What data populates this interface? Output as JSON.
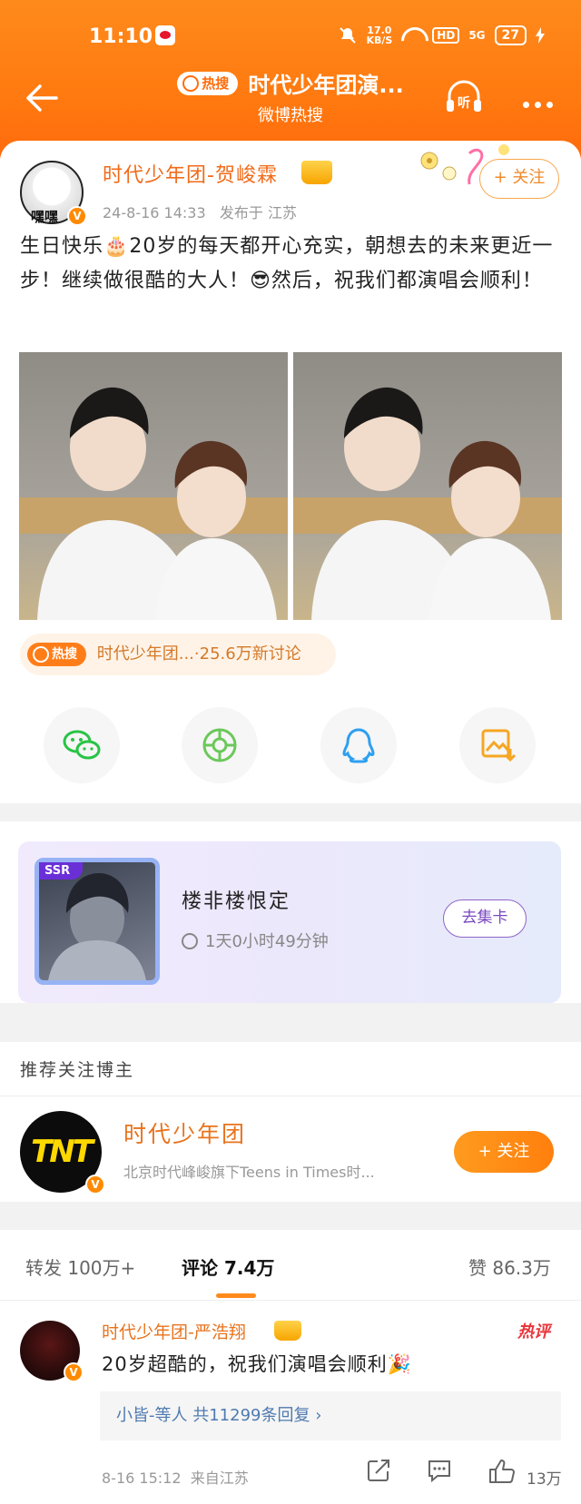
{
  "status_bar": {
    "time": "11:10",
    "speed_value": "17.0",
    "speed_unit": "KB/S",
    "hd": "HD",
    "network": "5G",
    "battery": "27"
  },
  "header": {
    "hot_badge": "热搜",
    "title": "时代少年团演...",
    "subtitle": "微博热搜",
    "listen": "听"
  },
  "post": {
    "avatar_caption": "嘿嘿",
    "username": "时代少年团-贺峻霖",
    "timestamp": "24-8-16 14:33",
    "location": "发布于 江苏",
    "follow_label": "+ 关注",
    "text": "生日快乐🎂20岁的每天都开心充实，朝想去的未来更近一步！继续做很酷的大人！😎然后，祝我们都演唱会顺利！",
    "topic": {
      "badge": "热搜",
      "label": "时代少年团...·25.6万新讨论"
    },
    "share_icons": [
      "wechat-icon",
      "moments-icon",
      "qq-icon",
      "save-image-icon"
    ]
  },
  "collect_card": {
    "tag": "SSR",
    "title": "楼非楼恨定",
    "timer": "1天0小时49分钟",
    "button": "去集卡"
  },
  "recommend": {
    "heading": "推荐关注博主",
    "avatar_text": "TNT",
    "name": "时代少年团",
    "description": "北京时代峰峻旗下Teens in Times时...",
    "follow_label": "+ 关注"
  },
  "comments": {
    "tabs": [
      {
        "label": "转发 100万+"
      },
      {
        "label": "评论 7.4万"
      },
      {
        "label": "赞 86.3万"
      }
    ],
    "items": [
      {
        "user": "时代少年团-严浩翔",
        "hot_tag": "热评",
        "text": "20岁超酷的，祝我们演唱会顺利🎉",
        "reply_summary": "小皆-等人 共11299条回复 ›",
        "time": "8-16 15:12",
        "location": "来自江苏",
        "likes": "13万"
      }
    ]
  },
  "colors": {
    "brand_orange": "#ff7a10",
    "username_orange": "#e8731d",
    "link_blue": "#4f7ab0"
  }
}
